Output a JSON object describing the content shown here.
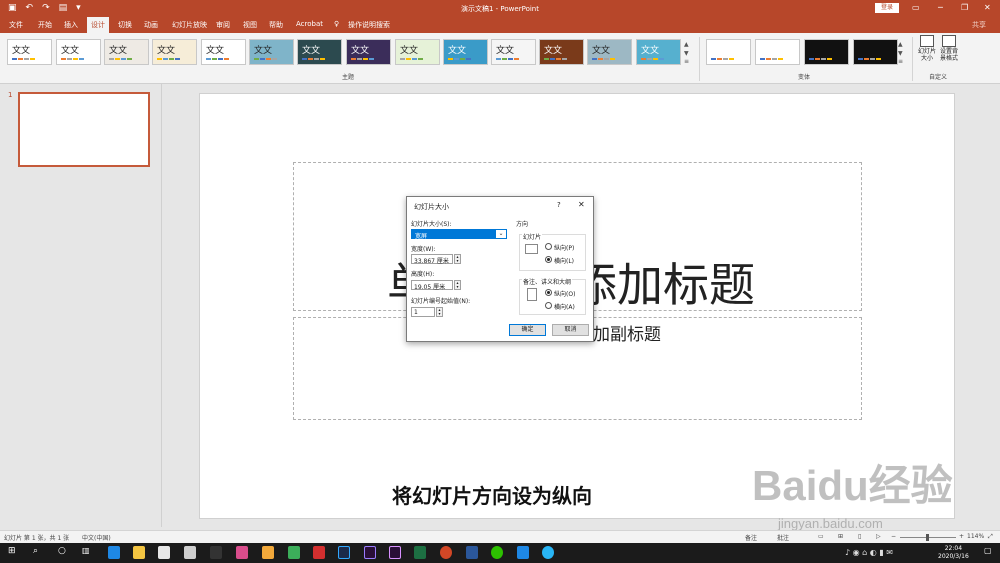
{
  "app": {
    "title": "演示文稿1 - PowerPoint",
    "login": "登录",
    "share": "共享"
  },
  "tabs": [
    "文件",
    "开始",
    "插入",
    "设计",
    "切换",
    "动画",
    "幻灯片放映",
    "审阅",
    "视图",
    "帮助",
    "Acrobat",
    "操作说明搜索"
  ],
  "active_tab": "设计",
  "themes": [
    {
      "label": "文文",
      "bg": "#ffffff"
    },
    {
      "label": "文文",
      "bg": "#ffffff"
    },
    {
      "label": "文文",
      "bg": "#eeeae4"
    },
    {
      "label": "文文",
      "bg": "#f6edd8"
    },
    {
      "label": "文文",
      "bg": "#ffffff"
    },
    {
      "label": "文文",
      "bg": "#7fb4c9"
    },
    {
      "label": "文文",
      "bg": "#2c4a4f"
    },
    {
      "label": "文文",
      "bg": "#3b2d5a"
    },
    {
      "label": "文文",
      "bg": "#e6f2d8"
    },
    {
      "label": "文文",
      "bg": "#3a9bc8"
    },
    {
      "label": "文文",
      "bg": "#f5f5f5"
    },
    {
      "label": "文文",
      "bg": "#7a3a1a"
    },
    {
      "label": "文文",
      "bg": "#9db8c4"
    },
    {
      "label": "文文",
      "bg": "#56b0cf"
    }
  ],
  "variants": [
    {
      "bg": "#ffffff"
    },
    {
      "bg": "#ffffff"
    },
    {
      "bg": "#111111"
    },
    {
      "bg": "#111111"
    }
  ],
  "groups": {
    "themes": "主题",
    "variants": "变体",
    "customize": "自定义"
  },
  "customize_buttons": [
    {
      "label": "幻灯片大小"
    },
    {
      "label": "设置背景格式"
    }
  ],
  "slide_number": "1",
  "slide": {
    "title": "单击此处添加标题",
    "subtitle": "单击此处添加副标题"
  },
  "dialog": {
    "title": "幻灯片大小",
    "help": "?",
    "close": "✕",
    "size_label": "幻灯片大小(S):",
    "size_value": "宽屏",
    "width_label": "宽度(W):",
    "width_value": "33.867 厘米",
    "height_label": "高度(H):",
    "height_value": "19.05 厘米",
    "start_label": "幻灯片编号起始值(N):",
    "start_value": "1",
    "orientation_label": "方向",
    "slides_group": "幻灯片",
    "slides_portrait": "纵向(P)",
    "slides_landscape": "横向(L)",
    "notes_group": "备注、讲义和大纲",
    "notes_portrait": "纵向(O)",
    "notes_landscape": "横向(A)",
    "ok": "确定",
    "cancel": "取消"
  },
  "caption": "将幻灯片方向设为纵向",
  "watermark": {
    "brand": "Baidu经验",
    "url": "jingyan.baidu.com"
  },
  "status": {
    "slide_info": "幻灯片 第 1 张，共 1 张",
    "language": "中文(中国)",
    "notes": "备注",
    "comments": "批注",
    "zoom": "114%"
  },
  "clock": {
    "time": "22:04",
    "date": "2020/3/16"
  }
}
